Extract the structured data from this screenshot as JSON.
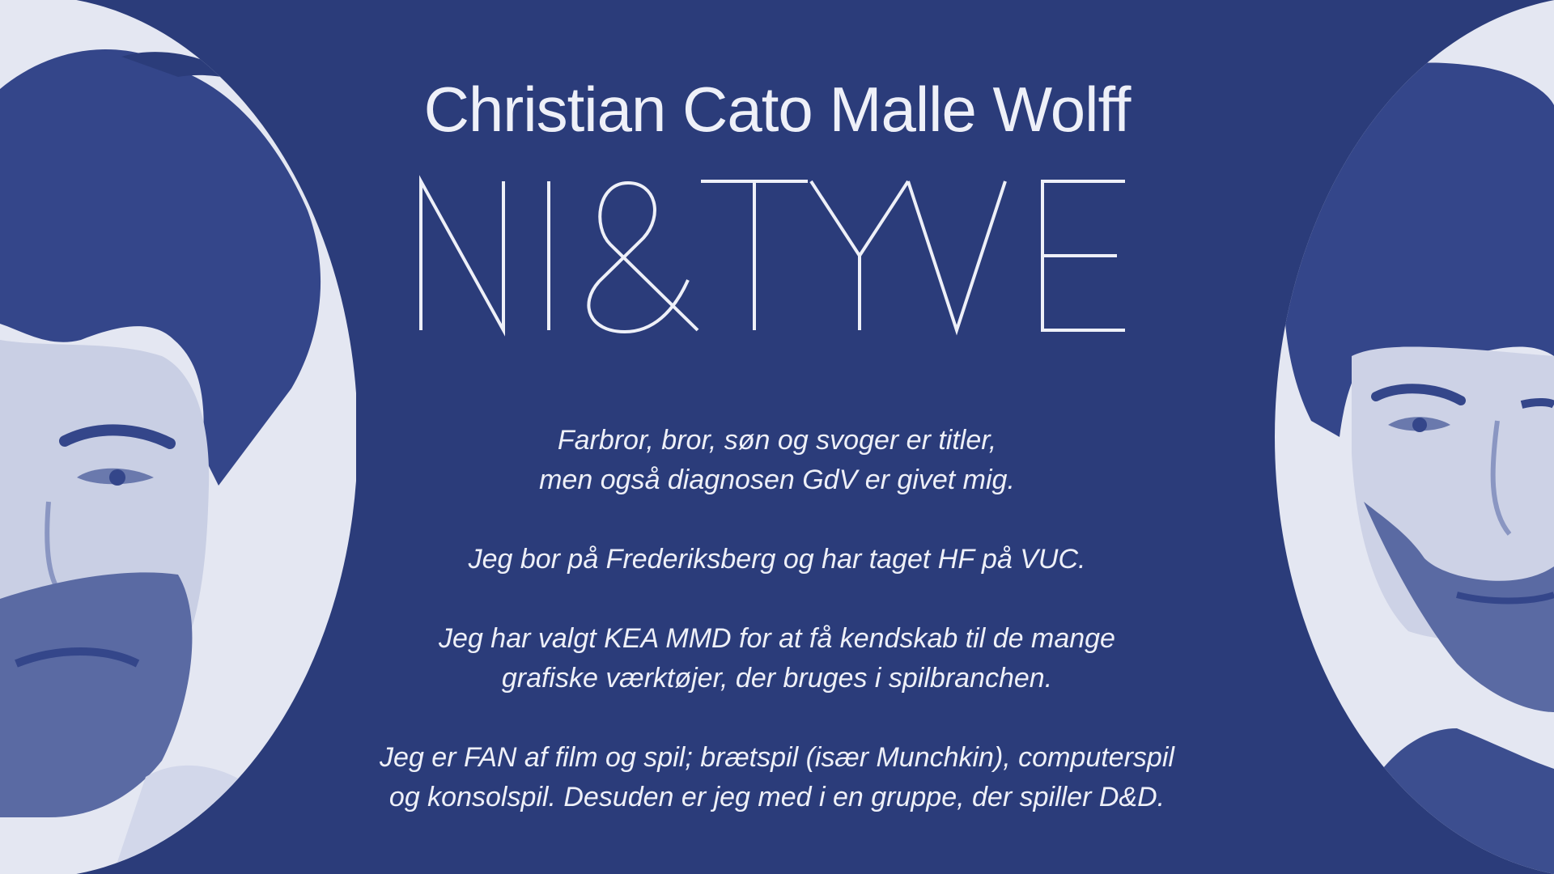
{
  "header": {
    "name": "Christian Cato Malle Wolff"
  },
  "logo": {
    "text": "NI&TYVE"
  },
  "bio": {
    "p1": {
      "line1": "Farbror, bror, søn og svoger er titler,",
      "line2": "men også diagnosen GdV er givet mig."
    },
    "p2": {
      "line1": "Jeg bor på Frederiksberg og har taget HF på VUC."
    },
    "p3": {
      "line1": "Jeg har valgt KEA MMD for at få kendskab til de mange",
      "line2": "grafiske værktøjer, der bruges i spilbranchen."
    },
    "p4": {
      "line1": "Jeg er FAN af film og spil; brætspil (især Munchkin), computerspil",
      "line2": "og konsolspil. Desuden er jeg med i en gruppe, der spiller D&D."
    }
  },
  "colors": {
    "background": "#2b3c7a",
    "text": "#eef0f8",
    "portrait_light": "#e4e7f2",
    "portrait_dark": "#34468a"
  }
}
